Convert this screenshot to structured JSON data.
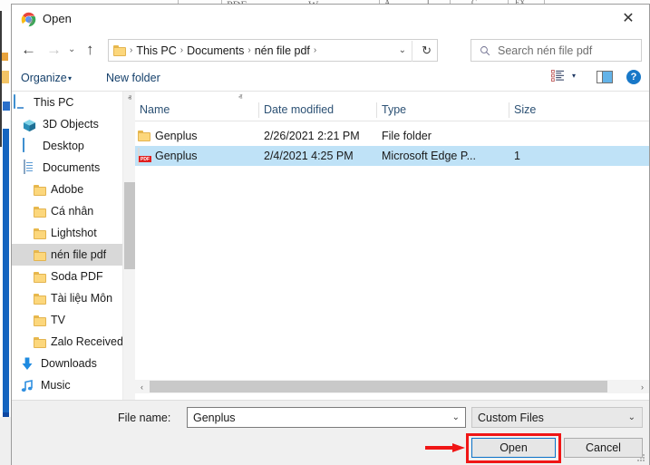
{
  "window": {
    "title": "Open",
    "app_icon": "chrome-icon",
    "close_label": "✕"
  },
  "background": {
    "glyphs": [
      "PDF",
      "W",
      "A",
      "J",
      "C",
      "FX"
    ]
  },
  "navigation": {
    "back_icon": "←",
    "forward_icon": "→",
    "recent_icon": "⌄",
    "up_icon": "↑",
    "refresh_icon": "↻",
    "dropdown_icon": "⌄",
    "breadcrumbs": [
      "This PC",
      "Documents",
      "nén file pdf"
    ],
    "separator": "›"
  },
  "search": {
    "placeholder": "Search nén file pdf",
    "icon": "search-icon"
  },
  "toolbar": {
    "organize_label": "Organize",
    "organize_caret": "▾",
    "new_folder_label": "New folder",
    "view_caret": "▾",
    "help_label": "?"
  },
  "sidebar": {
    "items": [
      {
        "label": "This PC",
        "icon": "pc-icon",
        "indent": 0,
        "selected": false
      },
      {
        "label": "3D Objects",
        "icon": "3d-objects-icon",
        "indent": 1,
        "selected": false
      },
      {
        "label": "Desktop",
        "icon": "desktop-icon",
        "indent": 1,
        "selected": false
      },
      {
        "label": "Documents",
        "icon": "documents-icon",
        "indent": 1,
        "selected": false
      },
      {
        "label": "Adobe",
        "icon": "folder-icon",
        "indent": 2,
        "selected": false
      },
      {
        "label": "Cá nhân",
        "icon": "folder-icon",
        "indent": 2,
        "selected": false
      },
      {
        "label": "Lightshot",
        "icon": "folder-icon",
        "indent": 2,
        "selected": false
      },
      {
        "label": "nén file pdf",
        "icon": "folder-icon",
        "indent": 2,
        "selected": true
      },
      {
        "label": "Soda PDF",
        "icon": "folder-icon",
        "indent": 2,
        "selected": false
      },
      {
        "label": "Tài liệu Môn",
        "icon": "folder-icon",
        "indent": 2,
        "selected": false
      },
      {
        "label": "TV",
        "icon": "folder-icon",
        "indent": 2,
        "selected": false
      },
      {
        "label": "Zalo Received Files",
        "icon": "folder-icon",
        "indent": 2,
        "selected": false
      },
      {
        "label": "Downloads",
        "icon": "downloads-icon",
        "indent": 1,
        "selected": false
      },
      {
        "label": "Music",
        "icon": "music-icon",
        "indent": 1,
        "selected": false
      }
    ],
    "scroll_up_icon": "ⱏ",
    "scroll_down_icon": "ⱟ"
  },
  "filelist": {
    "sort_indicator": "ⱏ",
    "columns": [
      "Name",
      "Date modified",
      "Type",
      "Size"
    ],
    "rows": [
      {
        "name": "Genplus",
        "date": "2/26/2021 2:21 PM",
        "type": "File folder",
        "size": "",
        "icon": "folder-icon",
        "selected": false
      },
      {
        "name": "Genplus",
        "date": "2/4/2021 4:25 PM",
        "type": "Microsoft Edge P...",
        "size": "1",
        "icon": "pdf-icon",
        "selected": true
      }
    ],
    "hscroll_left_icon": "‹",
    "hscroll_right_icon": "›"
  },
  "footer": {
    "file_name_label": "File name:",
    "file_name_value": "Genplus",
    "file_name_chevron": "⌄",
    "file_type_value": "Custom Files",
    "file_type_chevron": "⌄",
    "open_label": "Open",
    "cancel_label": "Cancel"
  },
  "annotation": {
    "color": "#f01616",
    "target": "open-button"
  },
  "colors": {
    "selection_blue": "#bfe2f7",
    "sidebar_selection": "#d8d8d8",
    "focus_border": "#0a72c9",
    "link_text": "#15406b",
    "annotation_red": "#f01616"
  }
}
